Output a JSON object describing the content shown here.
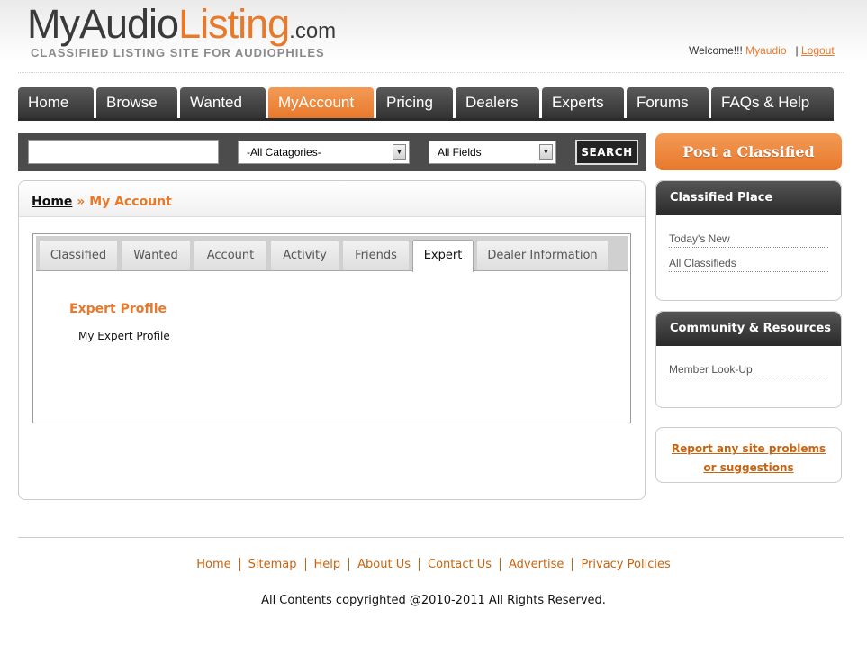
{
  "header": {
    "logo_part1": "MyAudio",
    "logo_part2": "Listing",
    "logo_part3": ".com",
    "tagline": "CLASSIFIED LISTING SITE FOR AUDIOPHILES",
    "welcome_text": "Welcome!!!",
    "username": "Myaudio",
    "separator": "|",
    "logout_label": "Logout"
  },
  "nav": {
    "items": [
      {
        "label": "Home"
      },
      {
        "label": "Browse"
      },
      {
        "label": "Wanted"
      },
      {
        "label": "MyAccount"
      },
      {
        "label": "Pricing"
      },
      {
        "label": "Dealers"
      },
      {
        "label": "Experts"
      },
      {
        "label": "Forums"
      },
      {
        "label": "FAQs & Help"
      }
    ],
    "active": "MyAccount"
  },
  "search": {
    "query": "",
    "category_value": "-All Catagories-",
    "field_value": "All Fields",
    "button_label": "SEARCH"
  },
  "post_button_label": "Post a Classified",
  "breadcrumb": {
    "home": "Home",
    "separator": "»",
    "current": "My Account"
  },
  "tabs": {
    "items": [
      {
        "label": "Classified"
      },
      {
        "label": "Wanted"
      },
      {
        "label": "Account"
      },
      {
        "label": "Activity"
      },
      {
        "label": "Friends"
      },
      {
        "label": "Expert"
      },
      {
        "label": "Dealer Information"
      }
    ],
    "active": "Expert"
  },
  "expert_section": {
    "heading": "Expert Profile",
    "link": "My Expert Profile"
  },
  "sidebar": {
    "classified_place": {
      "title": "Classified Place",
      "links": [
        "Today's New",
        "All Classifieds"
      ]
    },
    "community": {
      "title": "Community & Resources",
      "links": [
        "Member Look-Up"
      ]
    },
    "report": {
      "line1": "Report any site problems",
      "line2": "or suggestions"
    }
  },
  "footer": {
    "links": [
      "Home",
      "Sitemap",
      "Help",
      "About Us",
      "Contact Us",
      "Advertise",
      "Privacy Policies"
    ],
    "copyright": "All Contents copyrighted @2010-2011 All Rights Reserved."
  },
  "colors": {
    "accent": "#e8792b",
    "link_orange": "#c8640f",
    "nav_dark": "#333333"
  }
}
